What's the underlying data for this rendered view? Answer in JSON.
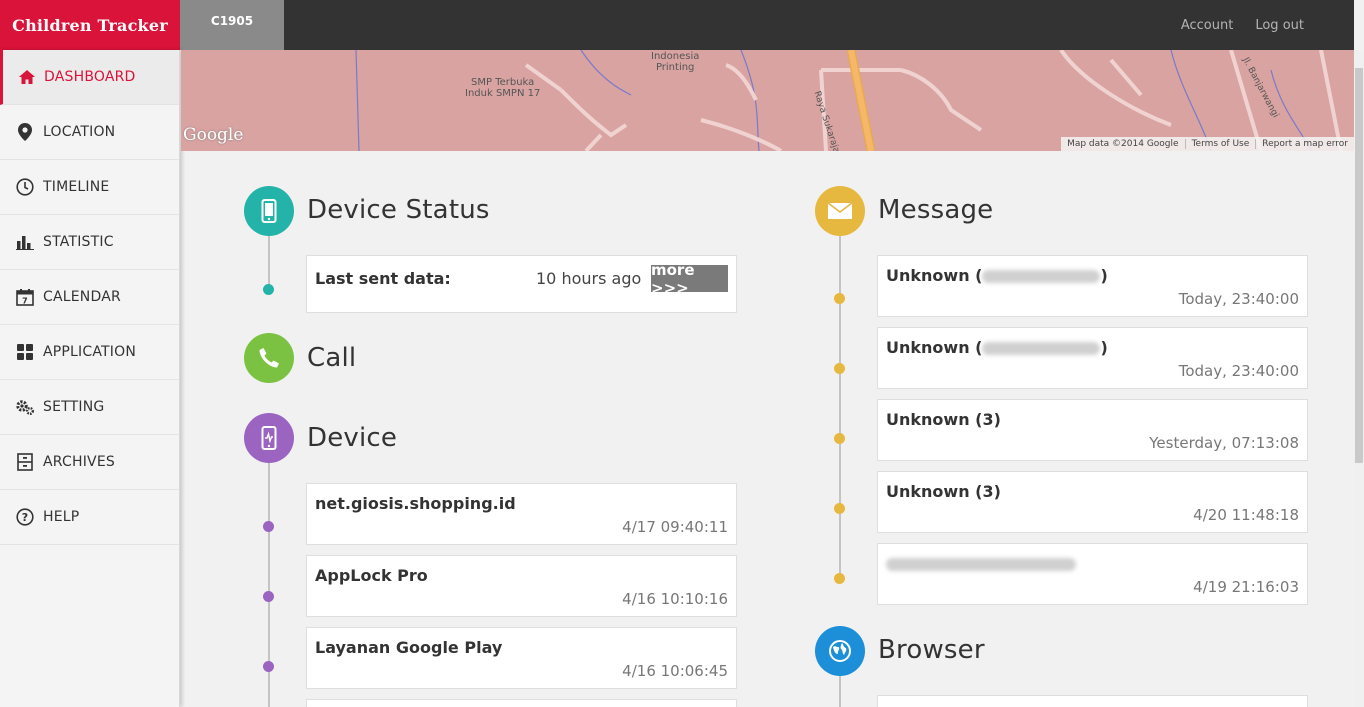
{
  "app": {
    "brand": "Children Tracker",
    "device_tab": "C1905"
  },
  "topbar": {
    "account": "Account",
    "logout": "Log out"
  },
  "sidebar": {
    "items": [
      {
        "label": "DASHBOARD",
        "icon": "home-icon"
      },
      {
        "label": "LOCATION",
        "icon": "map-pin-icon"
      },
      {
        "label": "TIMELINE",
        "icon": "clock-icon"
      },
      {
        "label": "STATISTIC",
        "icon": "bar-chart-icon"
      },
      {
        "label": "CALENDAR",
        "icon": "calendar-icon"
      },
      {
        "label": "APPLICATION",
        "icon": "grid-icon"
      },
      {
        "label": "SETTING",
        "icon": "gears-icon"
      },
      {
        "label": "ARCHIVES",
        "icon": "archive-icon"
      },
      {
        "label": "HELP",
        "icon": "help-icon"
      }
    ]
  },
  "map": {
    "labels": {
      "poi1": "Indonesia",
      "poi1b": "Printing",
      "poi2": "SMP Terbuka",
      "poi2b": "Induk SMPN 17",
      "road1": "Raya Sukaraja-S",
      "road2": "Jl. Banjarwangi"
    },
    "google": "Google",
    "footer": {
      "data": "Map data ©2014 Google",
      "terms": "Terms of Use",
      "report": "Report a map error"
    }
  },
  "device_status": {
    "title": "Device Status",
    "last_sent_label": "Last sent data:",
    "last_sent_value": "10 hours ago",
    "more": "more >>>"
  },
  "call": {
    "title": "Call"
  },
  "device": {
    "title": "Device",
    "items": [
      {
        "name": "net.giosis.shopping.id",
        "time": "4/17 09:40:11"
      },
      {
        "name": "AppLock Pro",
        "time": "4/16 10:10:16"
      },
      {
        "name": "Layanan Google Play",
        "time": "4/16 10:06:45"
      }
    ]
  },
  "message": {
    "title": "Message",
    "items": [
      {
        "name": "Unknown",
        "suffix": ")",
        "time": "Today, 23:40:00"
      },
      {
        "name": "Unknown",
        "suffix": ")",
        "time": "Today, 23:40:00"
      },
      {
        "name": "Unknown (3)",
        "suffix": "",
        "time": "Yesterday, 07:13:08"
      },
      {
        "name": "Unknown (3)",
        "suffix": "",
        "time": "4/20 11:48:18"
      },
      {
        "name": "",
        "suffix": "",
        "time": "4/19 21:16:03"
      }
    ]
  },
  "browser": {
    "title": "Browser"
  },
  "colors": {
    "brand": "#d9133a",
    "status": "#24b3a8",
    "call": "#7cc242",
    "device": "#9a64c0",
    "message": "#e6b840",
    "browser": "#1c8fd8"
  }
}
